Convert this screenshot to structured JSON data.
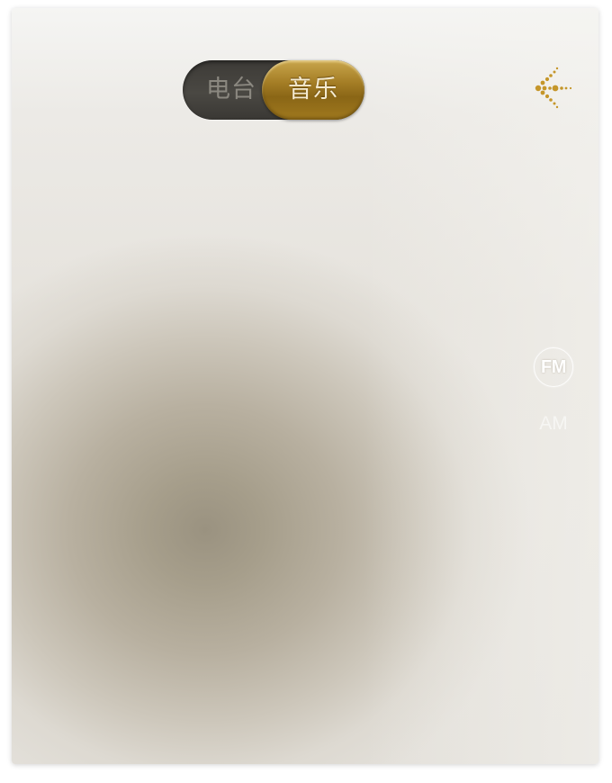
{
  "mode_toggle": {
    "options": [
      {
        "label": "电台",
        "selected": false
      },
      {
        "label": "音乐",
        "selected": true
      }
    ]
  },
  "back_button": {
    "icon": "dotted-arrow-left-icon",
    "color": "#c5962a"
  },
  "bands": {
    "fm": {
      "label": "FM",
      "selected": true
    },
    "am": {
      "label": "AM",
      "selected": false
    }
  },
  "colors": {
    "accent_gold": "#a47d25",
    "toggle_dark": "#45433e",
    "background_light": "#ecebe7",
    "glow_center": "#9a9280"
  }
}
